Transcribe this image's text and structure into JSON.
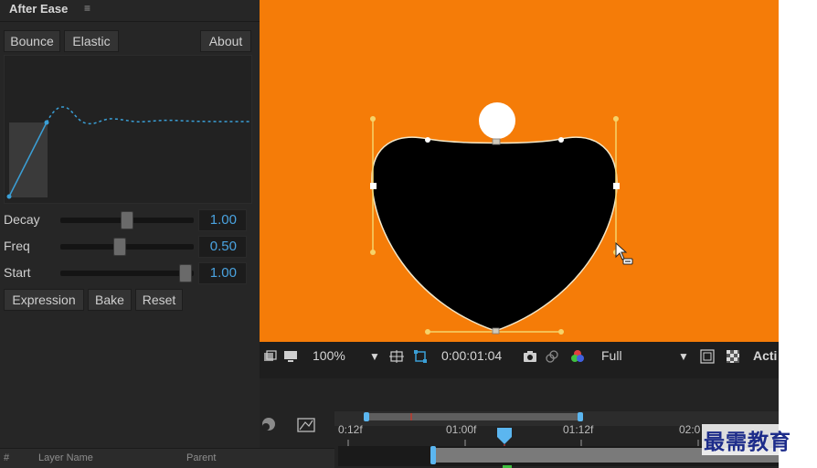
{
  "panel": {
    "title": "After Ease",
    "menu_glyph": "≡",
    "tabs": [
      {
        "label": "Bounce"
      },
      {
        "label": "Elastic"
      }
    ],
    "about_label": "About",
    "params": [
      {
        "label": "Decay",
        "value": "1.00",
        "level": 0.5
      },
      {
        "label": "Freq",
        "value": "0.50",
        "level": 0.45
      },
      {
        "label": "Start",
        "value": "1.00",
        "level": 1.0
      }
    ],
    "actions": [
      {
        "label": "Expression"
      },
      {
        "label": "Bake"
      },
      {
        "label": "Reset"
      }
    ]
  },
  "viewer": {
    "background_color": "#f57c08",
    "shape_fill": "#000000",
    "circle_fill": "#ffffff",
    "handle_color": "#f5c542"
  },
  "toolbar": {
    "zoom": "100%",
    "timecode": "0:00:01:04",
    "resolution": "Full",
    "active_camera": "Acti"
  },
  "timeline": {
    "ruler_labels": [
      "0:12f",
      "01:00f",
      "01:12f",
      "02:0"
    ]
  },
  "layer_header": {
    "hash": "#",
    "layer_name": "Layer Name",
    "parent": "Parent"
  },
  "watermark": "最需教育"
}
